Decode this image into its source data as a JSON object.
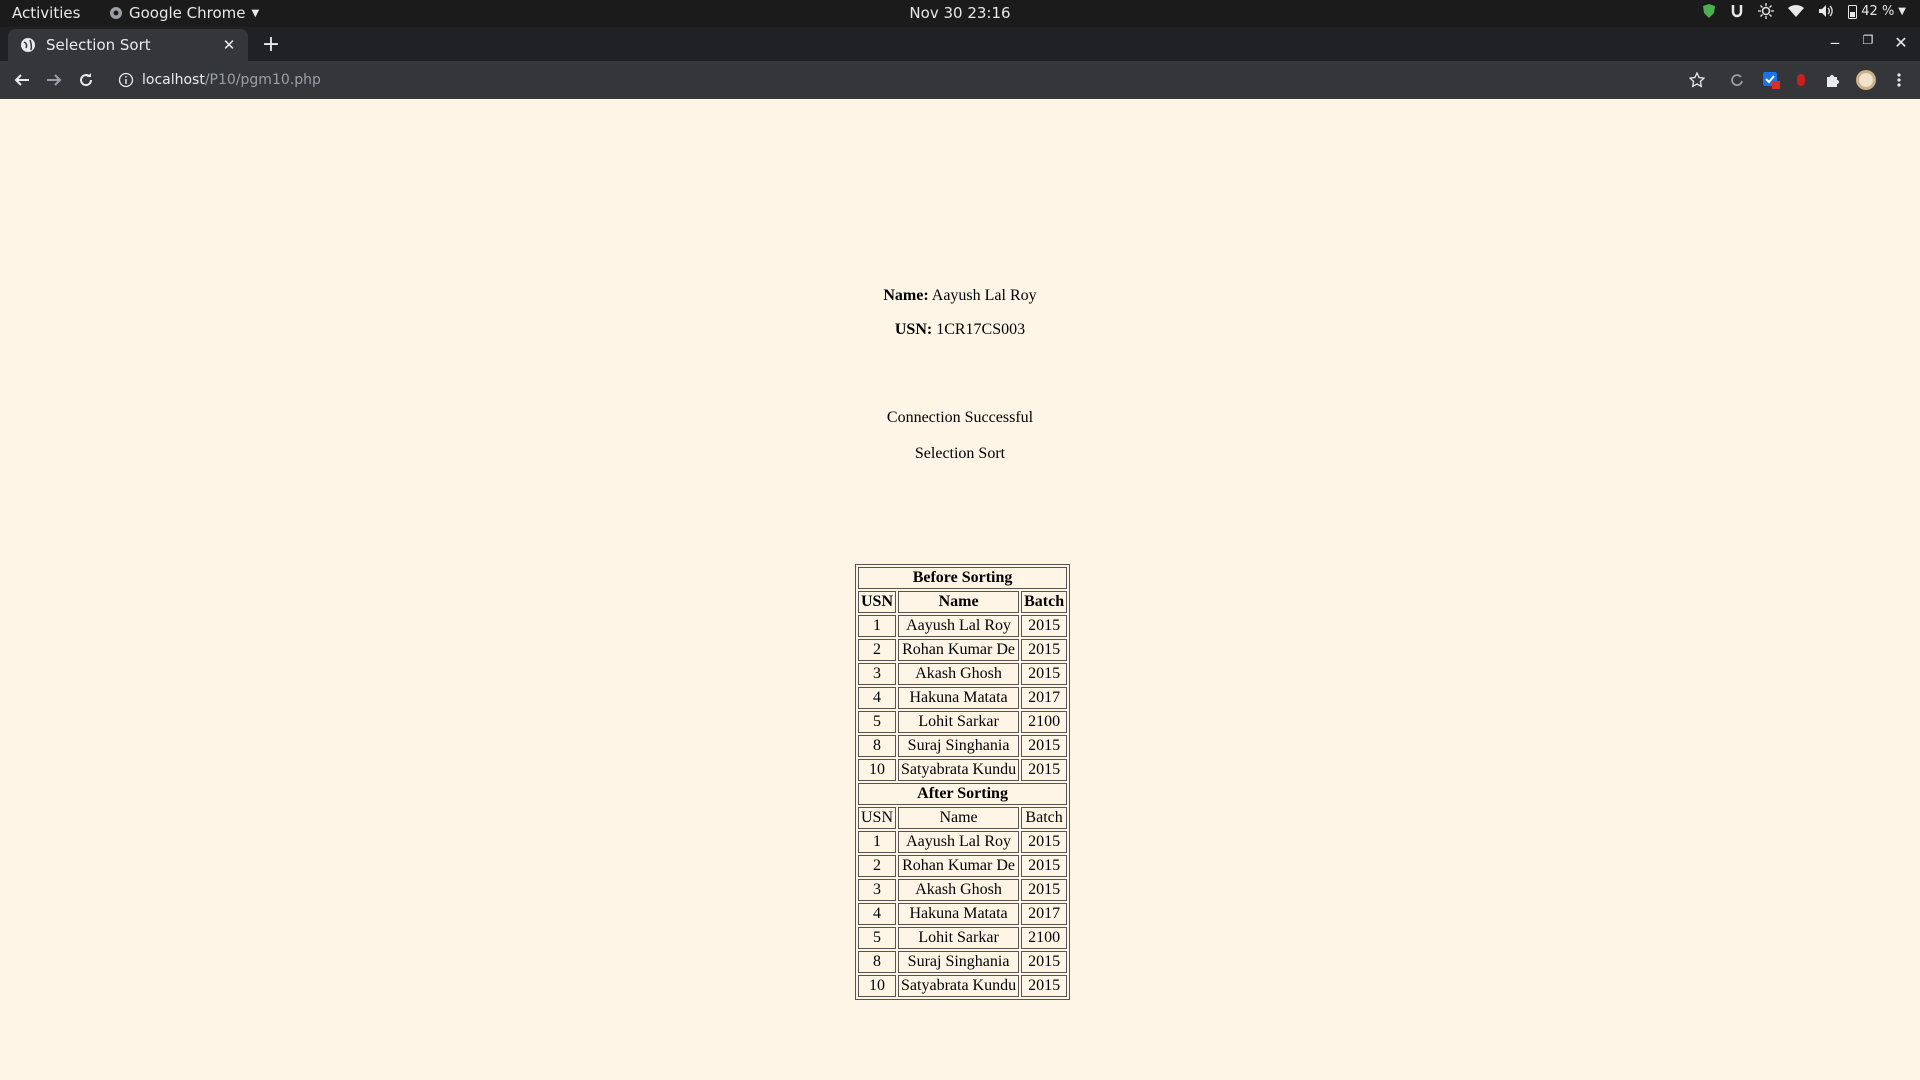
{
  "system": {
    "activities": "Activities",
    "app_name": "Google Chrome",
    "clock": "Nov 30  23:16",
    "battery": "42 %"
  },
  "browser": {
    "tab_title": "Selection Sort",
    "url_host": "localhost",
    "url_path": "/P10/pgm10.php"
  },
  "page": {
    "name_label": "Name:",
    "name_value": " Aayush Lal Roy",
    "usn_label": "USN:",
    "usn_value": " 1CR17CS003",
    "connection": "Connection Successful",
    "caption": "Selection Sort",
    "before_heading": "Before Sorting",
    "after_heading": "After Sorting",
    "columns": [
      "USN",
      "Name",
      "Batch"
    ],
    "before_rows": [
      [
        "1",
        "Aayush Lal Roy",
        "2015"
      ],
      [
        "2",
        "Rohan Kumar De",
        "2015"
      ],
      [
        "3",
        "Akash Ghosh",
        "2015"
      ],
      [
        "4",
        "Hakuna Matata",
        "2017"
      ],
      [
        "5",
        "Lohit Sarkar",
        "2100"
      ],
      [
        "8",
        "Suraj Singhania",
        "2015"
      ],
      [
        "10",
        "Satyabrata Kundu",
        "2015"
      ]
    ],
    "after_rows": [
      [
        "1",
        "Aayush Lal Roy",
        "2015"
      ],
      [
        "2",
        "Rohan Kumar De",
        "2015"
      ],
      [
        "3",
        "Akash Ghosh",
        "2015"
      ],
      [
        "4",
        "Hakuna Matata",
        "2017"
      ],
      [
        "5",
        "Lohit Sarkar",
        "2100"
      ],
      [
        "8",
        "Suraj Singhania",
        "2015"
      ],
      [
        "10",
        "Satyabrata Kundu",
        "2015"
      ]
    ]
  }
}
